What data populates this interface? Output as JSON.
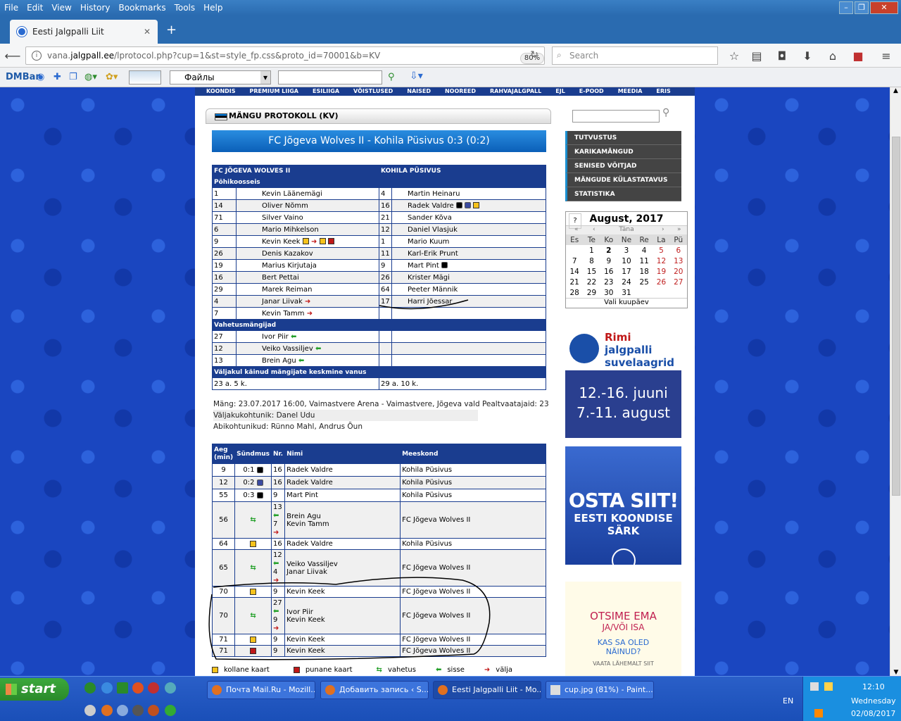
{
  "menu": [
    "File",
    "Edit",
    "View",
    "History",
    "Bookmarks",
    "Tools",
    "Help"
  ],
  "tab": {
    "title": "Eesti Jalgpalli Liit"
  },
  "url": {
    "prefix": "vana.",
    "domain": "jalgpall.ee",
    "path": "/lprotocol.php?cup=1&st=style_fp.css&proto_id=70001&b=KV",
    "zoom": "80%",
    "search": "Search"
  },
  "dmbar": {
    "label": "DMBar",
    "select": "Файлы"
  },
  "topnav": [
    "KOONDIS",
    "PREMIUM LIIGA",
    "ESILIIGA",
    "VÕISTLUSED",
    "NAISED",
    "NOOREED",
    "RAHVAJALGPALL",
    "EJL",
    "E-POOD",
    "MEEDIA",
    "ERIS"
  ],
  "protocol": {
    "title": "MÄNGU PROTOKOLL (KV)",
    "match": "FC Jõgeva Wolves II - Kohila Püsivus 0:3 (0:2)",
    "team1": "FC JÕGEVA WOLVES II",
    "team2": "KOHILA PÜSIVUS",
    "start_label": "Põhikoosseis",
    "subs_label": "Vahetusmängijad",
    "age_label": "Väljakul käinud mängijate keskmine vanus",
    "age1": "23 a. 5 k.",
    "age2": "29 a. 10 k."
  },
  "lineup": [
    {
      "n1": "1",
      "p1": "Kevin Läänemägi",
      "n2": "4",
      "p2": "Martin Heinaru"
    },
    {
      "n1": "14",
      "p1": "Oliver Nõmm",
      "n2": "16",
      "p2": "Radek Valdre"
    },
    {
      "n1": "71",
      "p1": "Silver Vaino",
      "n2": "21",
      "p2": "Sander Kõva"
    },
    {
      "n1": "6",
      "p1": "Mario Mihkelson",
      "n2": "12",
      "p2": "Daniel Vlasjuk"
    },
    {
      "n1": "9",
      "p1": "Kevin Keek",
      "n2": "1",
      "p2": "Mario Kuum"
    },
    {
      "n1": "26",
      "p1": "Denis Kazakov",
      "n2": "11",
      "p2": "Karl-Erik Prunt"
    },
    {
      "n1": "19",
      "p1": "Marius Kirjutaja",
      "n2": "9",
      "p2": "Mart Pint"
    },
    {
      "n1": "16",
      "p1": "Bert Pettai",
      "n2": "26",
      "p2": "Krister Mägi"
    },
    {
      "n1": "29",
      "p1": "Marek Reiman",
      "n2": "64",
      "p2": "Peeter Männik"
    },
    {
      "n1": "4",
      "p1": "Janar Liivak",
      "n2": "17",
      "p2": "Harri Jõessar"
    },
    {
      "n1": "7",
      "p1": "Kevin Tamm",
      "n2": "",
      "p2": ""
    }
  ],
  "subs": [
    {
      "n": "27",
      "p": "Ivor Piir"
    },
    {
      "n": "12",
      "p": "Veiko Vassiljev"
    },
    {
      "n": "13",
      "p": "Brein Agu"
    }
  ],
  "info": {
    "line1": "Mäng: 23.07.2017 16:00, Vaimastvere Arena - Vaimastvere, Jõgeva vald Pealtvaatajaid: 23",
    "line2": "Väljakukohtunik: Danel Udu",
    "line3": "Abikohtunikud: Rünno Mahl, Andrus Õun"
  },
  "events_header": {
    "min": "Aeg (min)",
    "ev": "Sündmus",
    "nr": "Nr.",
    "name": "Nimi",
    "team": "Meeskond"
  },
  "events": [
    {
      "min": "9",
      "ev": "0:1",
      "nr": "16",
      "name": "Radek Valdre",
      "team": "Kohila Püsivus"
    },
    {
      "min": "12",
      "ev": "0:2",
      "nr": "16",
      "name": "Radek Valdre",
      "team": "Kohila Püsivus"
    },
    {
      "min": "55",
      "ev": "0:3",
      "nr": "9",
      "name": "Mart Pint",
      "team": "Kohila Püsivus"
    },
    {
      "min": "56",
      "nr": "13",
      "nr2": "7",
      "name": "Brein Agu",
      "name2": "Kevin Tamm",
      "team": "FC Jõgeva Wolves II"
    },
    {
      "min": "64",
      "nr": "16",
      "name": "Radek Valdre",
      "team": "Kohila Püsivus"
    },
    {
      "min": "65",
      "nr": "12",
      "nr2": "4",
      "name": "Veiko Vassiljev",
      "name2": "Janar Liivak",
      "team": "FC Jõgeva Wolves II"
    },
    {
      "min": "70",
      "nr": "9",
      "name": "Kevin Keek",
      "team": "FC Jõgeva Wolves II"
    },
    {
      "min": "70",
      "nr": "27",
      "nr2": "9",
      "name": "Ivor Piir",
      "name2": "Kevin Keek",
      "team": "FC Jõgeva Wolves II"
    },
    {
      "min": "71",
      "nr": "9",
      "name": "Kevin Keek",
      "team": "FC Jõgeva Wolves II"
    },
    {
      "min": "71",
      "nr": "9",
      "name": "Kevin Keek",
      "team": "FC Jõgeva Wolves II"
    }
  ],
  "legend": {
    "yellow": "kollane kaart",
    "red": "punane kaart",
    "sub": "vahetus",
    "in": "sisse",
    "out": "välja"
  },
  "side_menu": [
    "TUTVUSTUS",
    "KARIKAMÄNGUD",
    "SENISED VÕITJAD",
    "MÄNGUDE KÜLASTATAVUS",
    "STATISTIKA"
  ],
  "calendar": {
    "q": "?",
    "month": "August, 2017",
    "today": "Täna",
    "days": [
      "Es",
      "Te",
      "Ko",
      "Ne",
      "Re",
      "La",
      "Pü"
    ],
    "footer": "Vali kuupäev"
  },
  "ad1": {
    "brand": "Rimi",
    "text": "jalgpalli",
    "text2": "suvelaagrid",
    "dates": "12.-16. juuni",
    "dates2": "7.-11. august"
  },
  "ad2": {
    "big": "OSTA SIIT!",
    "small": "EESTI KOONDISE SÄRK"
  },
  "ad3": {
    "a": "OTSIME EMA",
    "b": "JA/VÕI ISA",
    "c": "KAS SA OLED",
    "c2": "NÄINUD?",
    "d": "VAATA LÄHEMALT SIIT"
  },
  "taskbar": {
    "start": "start",
    "items": [
      "Почта Mail.Ru - Mozill...",
      "Добавить запись ‹ S...",
      "Eesti Jalgpalli Liit - Mo...",
      "cup.jpg (81%) - Paint..."
    ],
    "lang": "EN",
    "time": "12:10",
    "day": "Wednesday",
    "date": "02/08/2017"
  },
  "colors": {
    "brand": "#1a3d8f",
    "yellow": "#f6c21b",
    "red": "#c01818"
  }
}
